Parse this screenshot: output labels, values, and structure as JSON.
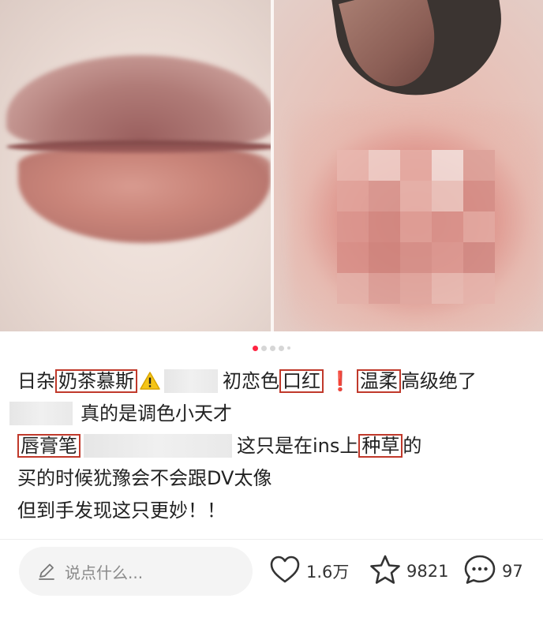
{
  "carousel": {
    "page_count": 5,
    "active_page": 1
  },
  "post": {
    "line1": {
      "pre": "日杂",
      "hl1": "奶茶慕斯",
      "mid": "初恋色",
      "hl2": "口红",
      "excl": "❗",
      "hl3": "温柔",
      "post": "高级绝了"
    },
    "line2": {
      "text": "真的是调色小天才"
    },
    "line3": {
      "hl1": "唇膏笔",
      "mid": "这只是在ins上",
      "hl2": "种草",
      "post": "的"
    },
    "line4": {
      "text": "买的时候犹豫会不会跟DV太像"
    },
    "line5": {
      "text": "但到手发现这只更妙！！"
    }
  },
  "bottom_bar": {
    "comment_placeholder": "说点什么...",
    "like_count": "1.6万",
    "favorite_count": "9821",
    "comment_count": "97"
  },
  "icons": [
    "pen-icon",
    "heart-icon",
    "star-icon",
    "comment-bubble-icon",
    "warning-icon"
  ],
  "colors": {
    "accent": "#ff2442",
    "highlight_box": "#c0392b"
  }
}
